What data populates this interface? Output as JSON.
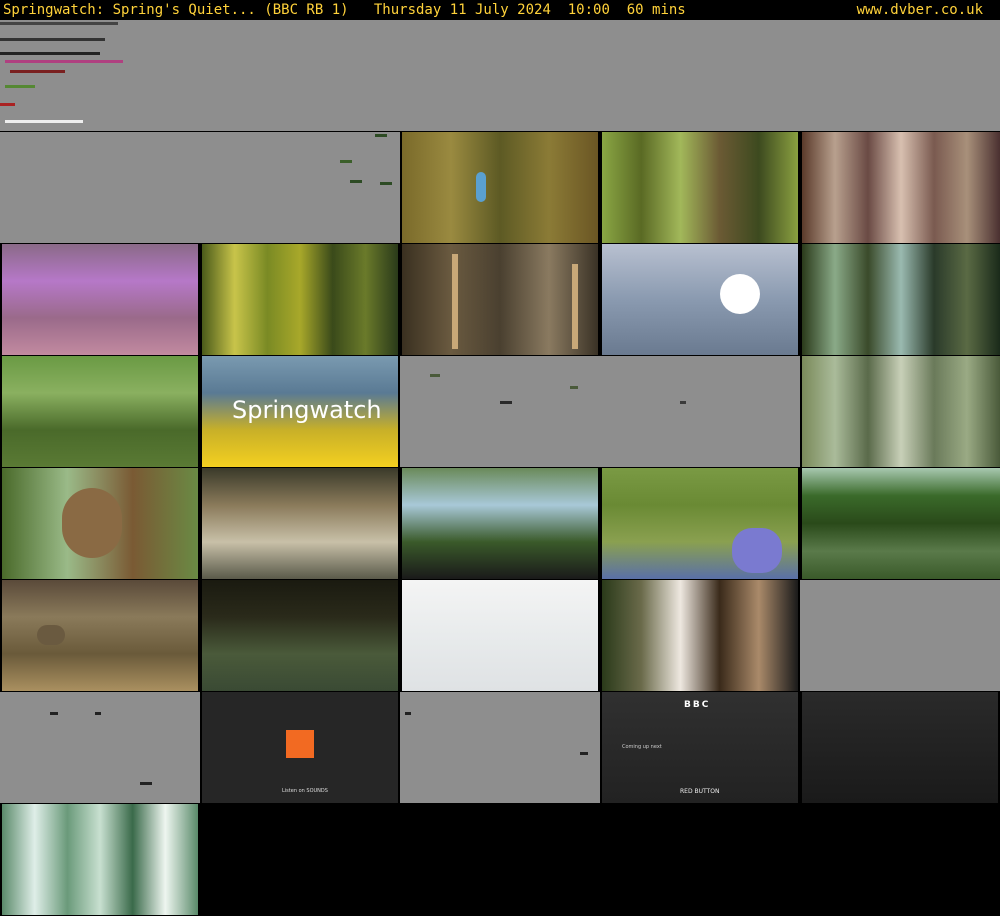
{
  "header": {
    "title": "Springwatch: Spring's Quiet... (BBC RB 1)   Thursday 11 July 2024  10:00  60 mins",
    "site": "www.dvber.co.uk"
  },
  "thumbnails": [
    {
      "name": "frame-01-glitch-wide",
      "label": ""
    },
    {
      "name": "frame-02-grey-glitch",
      "label": ""
    },
    {
      "name": "frame-03-kingfisher",
      "label": ""
    },
    {
      "name": "frame-04-green-foliage",
      "label": ""
    },
    {
      "name": "frame-05-purple-streaks",
      "label": ""
    },
    {
      "name": "frame-06-purple-flowers",
      "label": ""
    },
    {
      "name": "frame-07-yellow-green-stripes",
      "label": ""
    },
    {
      "name": "frame-08-reeds",
      "label": ""
    },
    {
      "name": "frame-09-egret",
      "label": ""
    },
    {
      "name": "frame-10-green-streaks",
      "label": ""
    },
    {
      "name": "frame-11-mossy-branch",
      "label": ""
    },
    {
      "name": "frame-12-springwatch-logo",
      "label": "Springwatch"
    },
    {
      "name": "frame-13-grey-glitch-wide",
      "label": ""
    },
    {
      "name": "frame-14-tree-trunks",
      "label": ""
    },
    {
      "name": "frame-15-squirrel",
      "label": ""
    },
    {
      "name": "frame-16-reed-bed",
      "label": ""
    },
    {
      "name": "frame-17-woodland-glitch",
      "label": ""
    },
    {
      "name": "frame-18-insect-bluebell",
      "label": ""
    },
    {
      "name": "frame-19-lake",
      "label": ""
    },
    {
      "name": "frame-20-ducks",
      "label": ""
    },
    {
      "name": "frame-21-water-vole",
      "label": ""
    },
    {
      "name": "frame-22-white-sky",
      "label": ""
    },
    {
      "name": "frame-23-streaked-woods",
      "label": ""
    },
    {
      "name": "frame-24-grey-glitch",
      "label": ""
    },
    {
      "name": "frame-25-grey-glitch",
      "label": ""
    },
    {
      "name": "frame-26-sounds-promo",
      "label": "Listen on SOUNDS"
    },
    {
      "name": "frame-27-grey-glitch",
      "label": ""
    },
    {
      "name": "frame-28-bbc-coming-up",
      "label": "Coming up next"
    },
    {
      "name": "frame-29-bbc-dark",
      "label": ""
    },
    {
      "name": "frame-30-green-stripes",
      "label": ""
    }
  ],
  "overlays": {
    "bbc_logo": "BBC",
    "red_button": "RED BUTTON"
  },
  "colors": {
    "header_text": "#ffd23a",
    "background": "#000000",
    "glitch_grey": "#8e8e8e"
  }
}
